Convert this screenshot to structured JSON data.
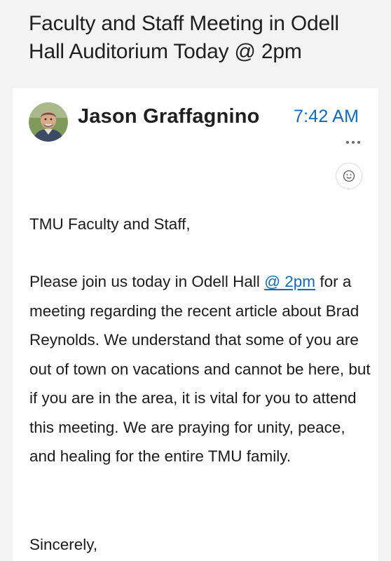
{
  "email": {
    "subject": "Faculty and Staff Meeting in Odell Hall Auditorium Today @ 2pm",
    "sender": "Jason Graffagnino",
    "time": "7:42 AM",
    "body": {
      "greeting": "TMU Faculty and Staff,",
      "paragraph_before_link": "Please join us today in Odell Hall ",
      "link_text": "@ 2pm",
      "paragraph_after_link": " for a meeting regarding the recent article about Brad Reynolds. We understand that some of you are out of town on vacations and cannot be here, but if you are in the area, it is vital for you to attend this meeting. We are praying for unity, peace, and healing for the entire TMU family.",
      "signoff": "Sincerely,"
    }
  },
  "icons": {
    "more": "more-horizontal-icon",
    "reaction": "smiley-face-icon",
    "avatar": "sender-avatar"
  },
  "colors": {
    "accent": "#0f6cbd",
    "header_background": "#f3f3f4",
    "text": "#1b1b1b"
  }
}
